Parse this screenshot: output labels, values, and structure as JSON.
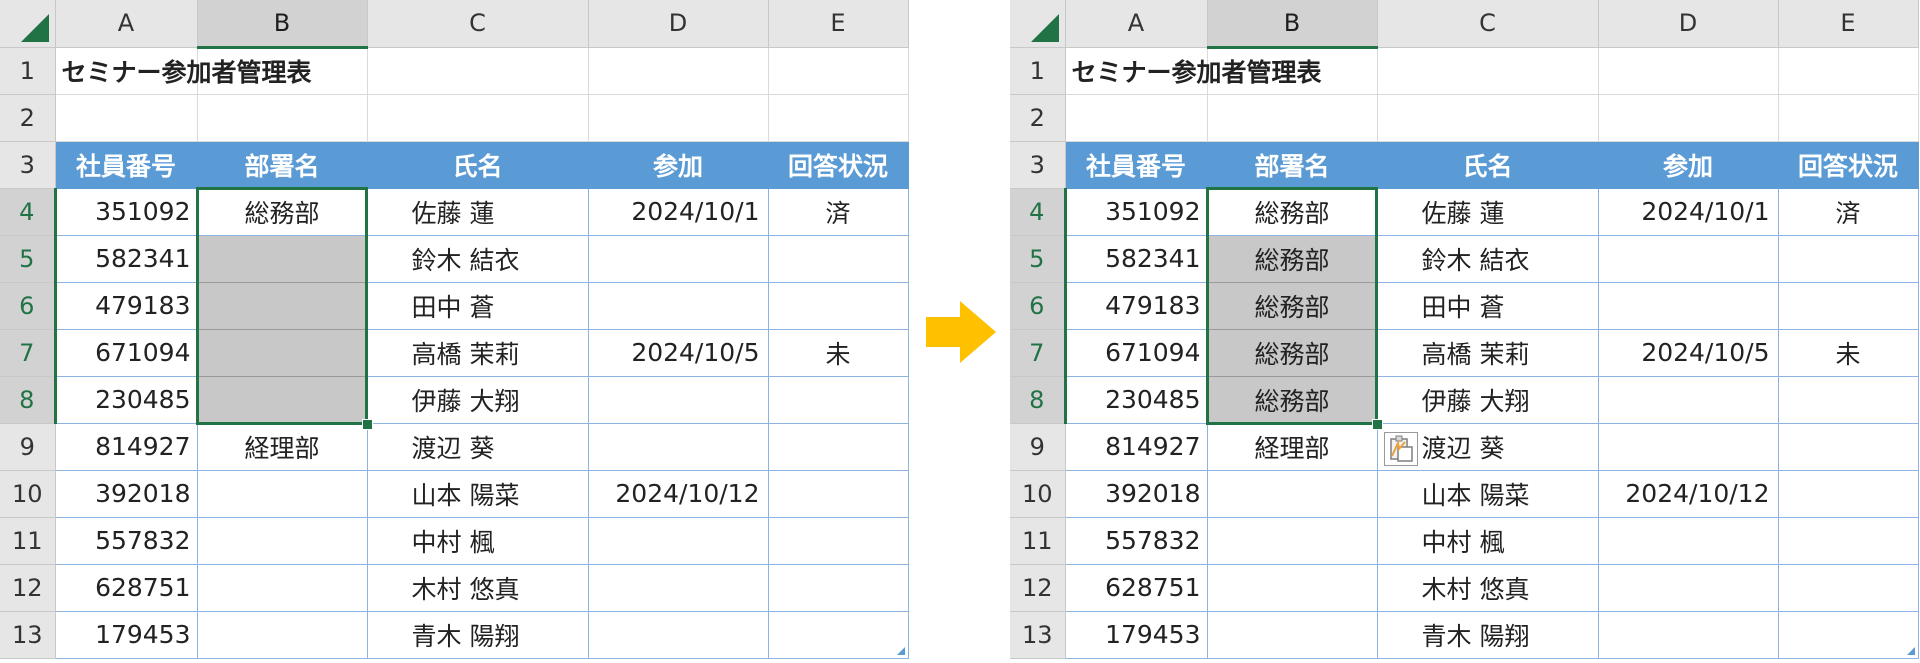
{
  "columns": [
    "A",
    "B",
    "C",
    "D",
    "E"
  ],
  "rows": [
    "1",
    "2",
    "3",
    "4",
    "5",
    "6",
    "7",
    "8",
    "9",
    "10",
    "11",
    "12",
    "13"
  ],
  "title": "セミナー参加者管理表",
  "headers": [
    "社員番号",
    "部署名",
    "氏名",
    "参加",
    "回答状況"
  ],
  "before": {
    "body": [
      [
        "351092",
        "総務部",
        "佐藤 蓮",
        "2024/10/1",
        "済"
      ],
      [
        "582341",
        "",
        "鈴木 結衣",
        "",
        ""
      ],
      [
        "479183",
        "",
        "田中 蒼",
        "",
        ""
      ],
      [
        "671094",
        "",
        "高橋 茉莉",
        "2024/10/5",
        "未"
      ],
      [
        "230485",
        "",
        "伊藤 大翔",
        "",
        ""
      ],
      [
        "814927",
        "経理部",
        "渡辺 葵",
        "",
        ""
      ],
      [
        "392018",
        "",
        "山本 陽菜",
        "2024/10/12",
        ""
      ],
      [
        "557832",
        "",
        "中村 楓",
        "",
        ""
      ],
      [
        "628751",
        "",
        "木村 悠真",
        "",
        ""
      ],
      [
        "179453",
        "",
        "青木 陽翔",
        "",
        ""
      ]
    ]
  },
  "after": {
    "body": [
      [
        "351092",
        "総務部",
        "佐藤 蓮",
        "2024/10/1",
        "済"
      ],
      [
        "582341",
        "総務部",
        "鈴木 結衣",
        "",
        ""
      ],
      [
        "479183",
        "総務部",
        "田中 蒼",
        "",
        ""
      ],
      [
        "671094",
        "総務部",
        "高橋 茉莉",
        "2024/10/5",
        "未"
      ],
      [
        "230485",
        "総務部",
        "伊藤 大翔",
        "",
        ""
      ],
      [
        "814927",
        "経理部",
        "渡辺 葵",
        "",
        ""
      ],
      [
        "392018",
        "",
        "山本 陽菜",
        "2024/10/12",
        ""
      ],
      [
        "557832",
        "",
        "中村 楓",
        "",
        ""
      ],
      [
        "628751",
        "",
        "木村 悠真",
        "",
        ""
      ],
      [
        "179453",
        "",
        "青木 陽翔",
        "",
        ""
      ]
    ]
  },
  "icons": {
    "arrow": "arrow-right-icon",
    "paste_options": "paste-options-icon",
    "select_all": "select-all-triangle-icon"
  },
  "colors": {
    "header_fill": "#5b9bd5",
    "selection": "#217346",
    "arrow": "#ffc000",
    "filled_gray": "#c8c8c8"
  }
}
